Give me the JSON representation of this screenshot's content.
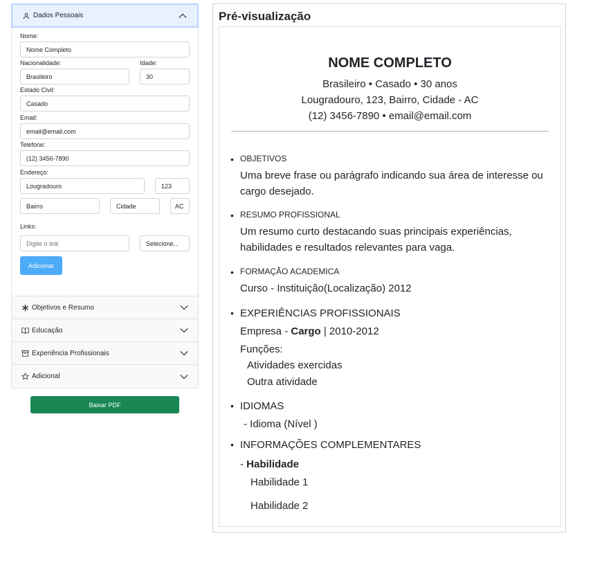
{
  "form": {
    "sections": [
      {
        "label": "Dados Pessoais",
        "icon": "person-icon",
        "open": true
      },
      {
        "label": "Objetivos e Resumo",
        "icon": "asterisk-icon",
        "open": false
      },
      {
        "label": "Educação",
        "icon": "book-icon",
        "open": false
      },
      {
        "label": "Experiência Profissionais",
        "icon": "archive-icon",
        "open": false
      },
      {
        "label": "Adicional",
        "icon": "star-icon",
        "open": false
      }
    ],
    "fields": {
      "nome_label": "Nome:",
      "nome_value": "Nome Completo",
      "nacionalidade_label": "Nacionalidade:",
      "nacionalidade_value": "Brasileiro",
      "idade_label": "Idade:",
      "idade_value": "30",
      "estado_civil_label": "Estado Civil:",
      "estado_civil_value": "Casado",
      "email_label": "Email:",
      "email_value": "email@email.com",
      "telefone_label": "Telefone:",
      "telefone_value": "(12) 3456-7890",
      "endereco_label": "Endereço:",
      "rua_value": "Lougradouro",
      "numero_value": "123",
      "bairro_value": "Bairro",
      "cidade_value": "Cidade",
      "uf_value": "AC",
      "links_label": "Links:",
      "link_placeholder": "Digite o link",
      "link_select": "Selecione..."
    },
    "add_button": "Adicionar",
    "download_button": "Baixar PDF"
  },
  "preview": {
    "title": "Pré-visualização",
    "name": "NOME COMPLETO",
    "line1": "Brasileiro • Casado • 30 anos",
    "line2": "Lougradouro, 123, Bairro, Cidade - AC",
    "line3": "(12) 3456-7890 • email@email.com",
    "objetivos": {
      "heading": "OBJETIVOS",
      "text1": "Uma breve frase ou parágrafo indicando sua área de interesse ou",
      "text2": "cargo desejado."
    },
    "resumo": {
      "heading": "RESUMO PROFISSIONAL",
      "text1": "Um resumo curto destacando suas principais experiências,",
      "text2": "habilidades e resultados relevantes para vaga."
    },
    "formacao": {
      "heading": "FORMAÇÃO ACADEMICA",
      "text": "Curso - Instituição(Localização) 2012"
    },
    "experiencias": {
      "heading": "EXPERIÊNCIAS PROFISSIONAIS",
      "empresa": "Empresa - ",
      "cargo": "Cargo",
      "periodo": " | 2010-2012",
      "funcoes_label": "Funções:",
      "funcao1": "Atividades exercidas",
      "funcao2": "Outra atividade"
    },
    "idiomas": {
      "heading": "IDIOMAS",
      "item": "- Idioma (Nível )"
    },
    "complementares": {
      "heading": "INFORMAÇÕES COMPLEMENTARES",
      "prefix": "- ",
      "habilidade_title": "Habilidade",
      "hab1": "Habilidade 1",
      "hab2": "Habilidade 2"
    }
  }
}
